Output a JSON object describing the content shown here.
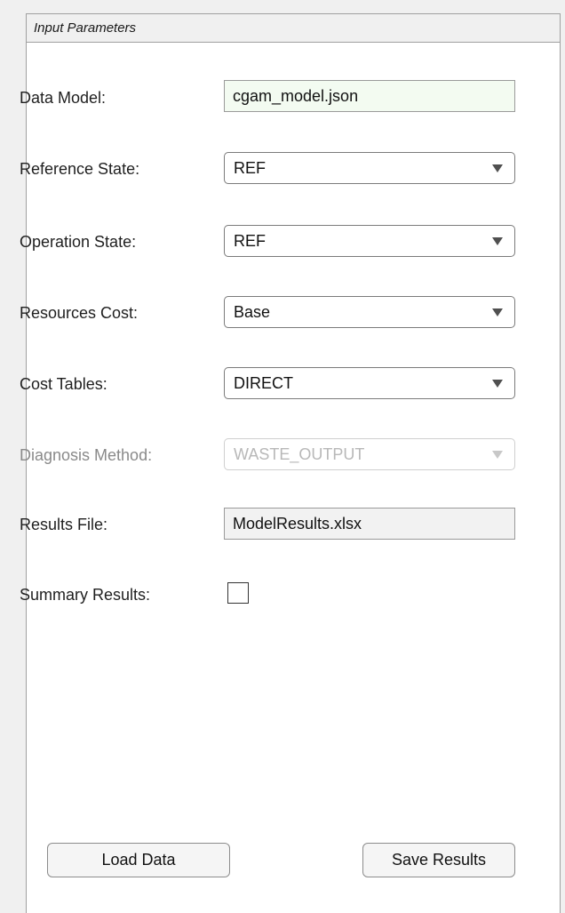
{
  "panel": {
    "title": "Input Parameters"
  },
  "fields": {
    "data_model": {
      "label": "Data Model:",
      "value": "cgam_model.json"
    },
    "reference_state": {
      "label": "Reference State:",
      "value": "REF"
    },
    "operation_state": {
      "label": "Operation State:",
      "value": "REF"
    },
    "resources_cost": {
      "label": "Resources Cost:",
      "value": "Base"
    },
    "cost_tables": {
      "label": "Cost Tables:",
      "value": "DIRECT"
    },
    "diagnosis_method": {
      "label": "Diagnosis Method:",
      "value": "WASTE_OUTPUT",
      "enabled": false
    },
    "results_file": {
      "label": "Results File:",
      "value": "ModelResults.xlsx"
    },
    "summary_results": {
      "label": "Summary Results:",
      "checked": false
    }
  },
  "buttons": {
    "load_data": "Load Data",
    "save_results": "Save Results"
  },
  "icons": {
    "dropdown": "chevron-down-icon"
  },
  "colors": {
    "editable_field_bg": "#f3fbf1",
    "readonly_field_bg": "#f2f2f2",
    "disabled_text": "#b8b8b8"
  }
}
